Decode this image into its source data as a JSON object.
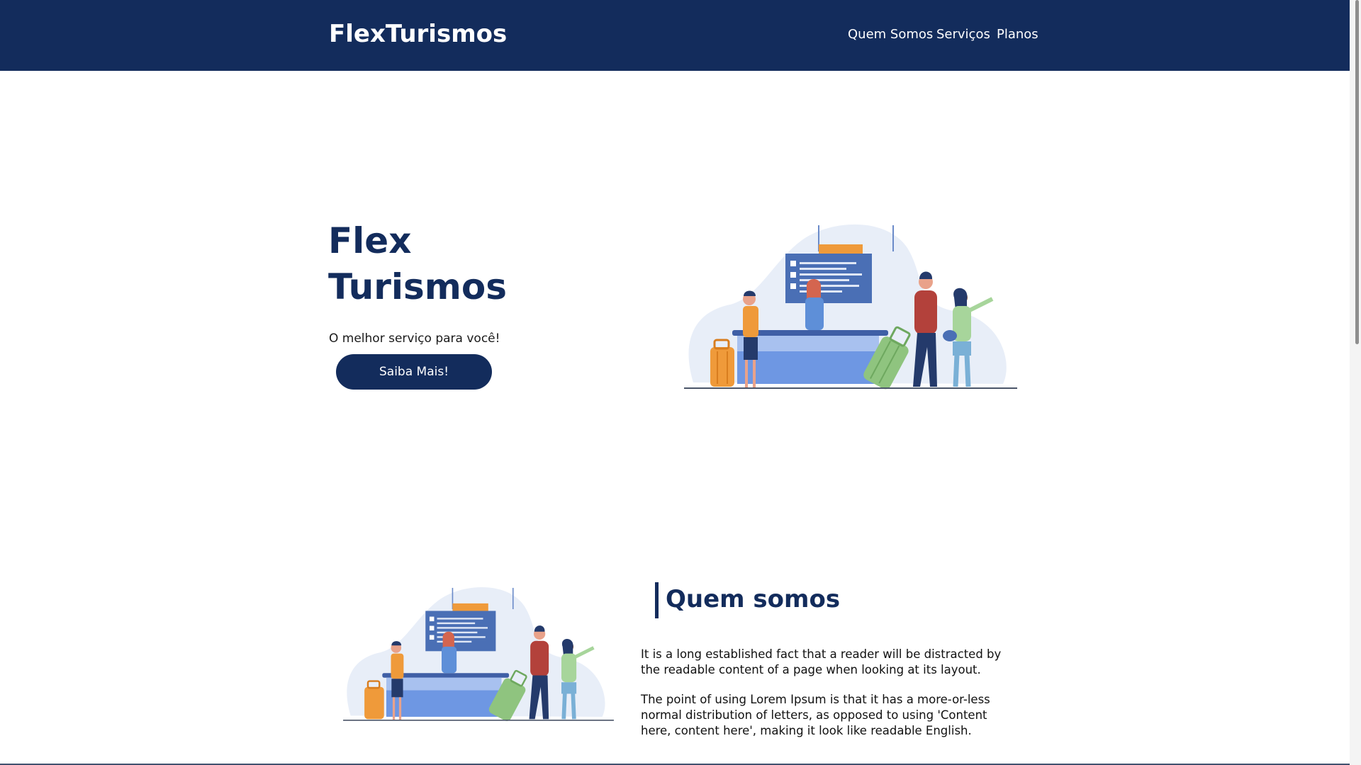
{
  "header": {
    "brand": "FlexTurismos",
    "nav": [
      {
        "label": "Quem Somos"
      },
      {
        "label": "Serviços"
      },
      {
        "label": "Planos"
      }
    ]
  },
  "hero": {
    "title_line1": "Flex",
    "title_line2": "Turismos",
    "subtitle": "O melhor serviço para você!",
    "cta_label": "Saiba Mais!"
  },
  "about": {
    "title": "Quem somos",
    "paragraphs": [
      "It is a long established fact that a reader will be distracted by the readable content of a page when looking at its layout.",
      "The point of using Lorem Ipsum is that it has a more-or-less normal distribution of letters, as opposed to using 'Content here, content here', making it look like readable English."
    ]
  },
  "colors": {
    "brand_navy": "#132c5c",
    "board_blue": "#4a6fb5",
    "desk_blue": "#6e97e3",
    "suitcase_orange": "#ef9a3a",
    "suitcase_green": "#8fc47f"
  },
  "icons": [
    "airport-checkin-illustration"
  ]
}
